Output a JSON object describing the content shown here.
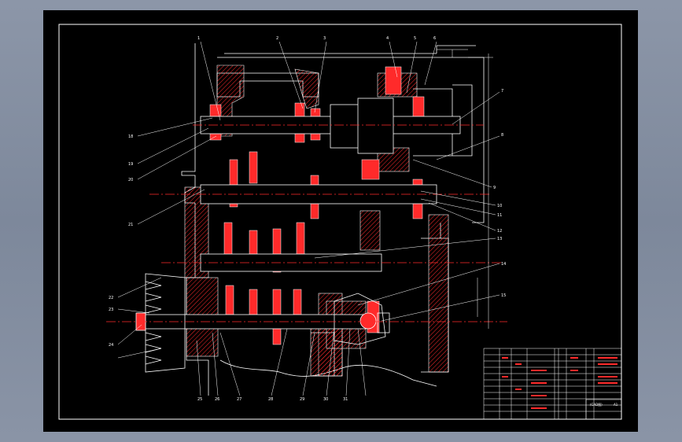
{
  "colors": {
    "background": "#000000",
    "frame": "#ffffff",
    "section": "#ff2a2a",
    "centerline": "#ff2a2a",
    "leader": "#ffffff",
    "dim": "#ffffff",
    "outer": "#8c96a8"
  },
  "drawing": {
    "title_block_label": "(CAD图)",
    "sheet_label": "A1",
    "callouts_top": [
      "1",
      "2",
      "3",
      "4",
      "5",
      "6"
    ],
    "callouts_right": [
      "7",
      "8",
      "9",
      "10",
      "11",
      "12",
      "13",
      "14",
      "15"
    ],
    "callouts_left": [
      "18",
      "19",
      "20",
      "21",
      "22",
      "23",
      "24"
    ],
    "callouts_bottom": [
      "25",
      "26",
      "27",
      "28",
      "29",
      "30",
      "31"
    ]
  }
}
